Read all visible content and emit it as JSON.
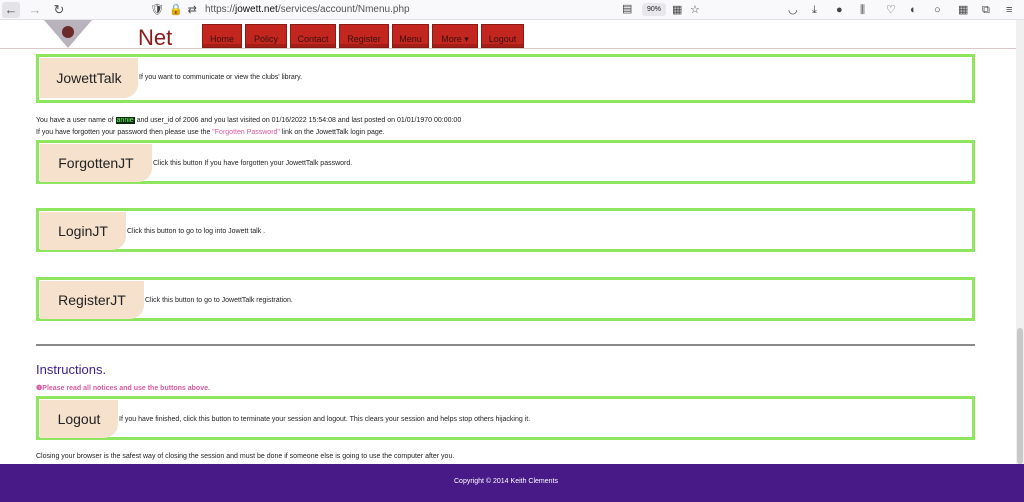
{
  "browser": {
    "url_scheme": "https://",
    "url_domain": "jowett.net",
    "url_path": "/services/account/Nmenu.php",
    "zoom": "90%"
  },
  "header": {
    "site_name": "Net",
    "menu": [
      "Home",
      "Policy",
      "Contact",
      "Register",
      "Menu",
      "More ▾",
      "Logout"
    ]
  },
  "boxes": {
    "jowetttalk": {
      "label": "JowettTalk",
      "desc": "If you want to communicate or view the clubs' library."
    },
    "forgotten": {
      "label": "ForgottenJT",
      "desc": "Click this button If you have forgotten your JowettTalk password."
    },
    "login": {
      "label": "LoginJT",
      "desc": "Click this button to go to log into Jowett talk ."
    },
    "register": {
      "label": "RegisterJT",
      "desc": "Click this button to go to JowettTalk registration."
    },
    "logout": {
      "label": "Logout",
      "desc": "If you have finished, click this button to terminate your session and logout. This clears your session and helps stop others hijacking it."
    }
  },
  "info": {
    "line1_pre": "You have a user name of",
    "username": "annie",
    "line1_post": "and user_id of 2006 and you last visited on 01/16/2022 15:54:08 and last posted on 01/01/1970 00:00:00",
    "line2_pre": "If you have forgotten your password then please use the",
    "line2_link": "\"Forgotten Password\"",
    "line2_post": "link on the JowettTalk login page."
  },
  "instructions": {
    "title": "Instructions.",
    "notice": "Please read all notices and use the buttons above.",
    "closing": "Closing your browser is the safest way of closing the session and must be done if someone else is going to use the computer after you."
  },
  "footer": {
    "copyright": "Copyright © 2014 Keith Clements"
  },
  "colors": {
    "box_border": "#8ee65f",
    "button_fill": "#f5e1cc",
    "menu_red": "#c2261f",
    "footer": "#481a87",
    "link_pink": "#d75aa0"
  }
}
